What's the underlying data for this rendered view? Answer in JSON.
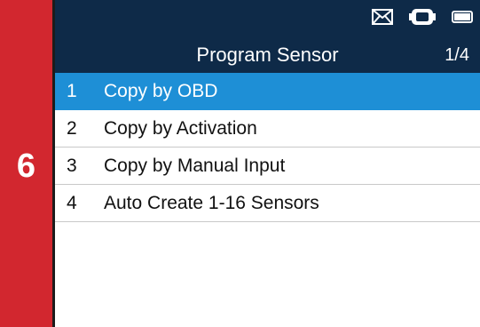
{
  "section_number": "6",
  "status_icons": [
    "mail-icon",
    "car-link-icon",
    "battery-icon"
  ],
  "header": {
    "title": "Program Sensor",
    "page": "1/4"
  },
  "menu": {
    "selected_index": 0,
    "items": [
      {
        "num": "1",
        "label": "Copy by OBD"
      },
      {
        "num": "2",
        "label": "Copy by Activation"
      },
      {
        "num": "3",
        "label": "Copy by Manual Input"
      },
      {
        "num": "4",
        "label": "Auto Create 1-16 Sensors"
      }
    ]
  },
  "colors": {
    "side_tab": "#d2272f",
    "header": "#0e2a48",
    "selection": "#1e8fd6"
  }
}
